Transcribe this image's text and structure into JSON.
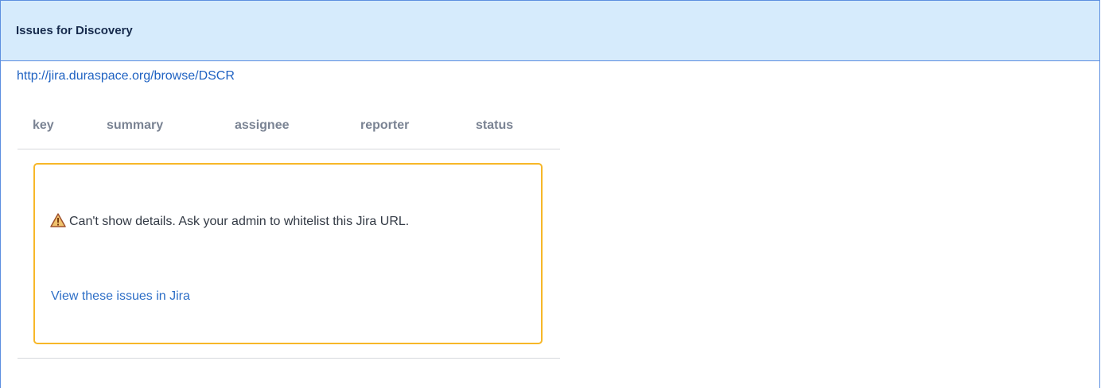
{
  "panel": {
    "title": "Issues for Discovery"
  },
  "source_link": "http://jira.duraspace.org/browse/DSCR",
  "table": {
    "columns": [
      "key",
      "summary",
      "assignee",
      "reporter",
      "status"
    ]
  },
  "warning": {
    "icon": "warning-triangle-icon",
    "message": "Can't show details. Ask your admin to whitelist this Jira URL.",
    "link_label": "View these issues in Jira"
  },
  "colors": {
    "header_bg": "#d6ebfc",
    "panel_border": "#5d8fe0",
    "warning_border": "#f7b728",
    "link": "#1f62c2"
  }
}
